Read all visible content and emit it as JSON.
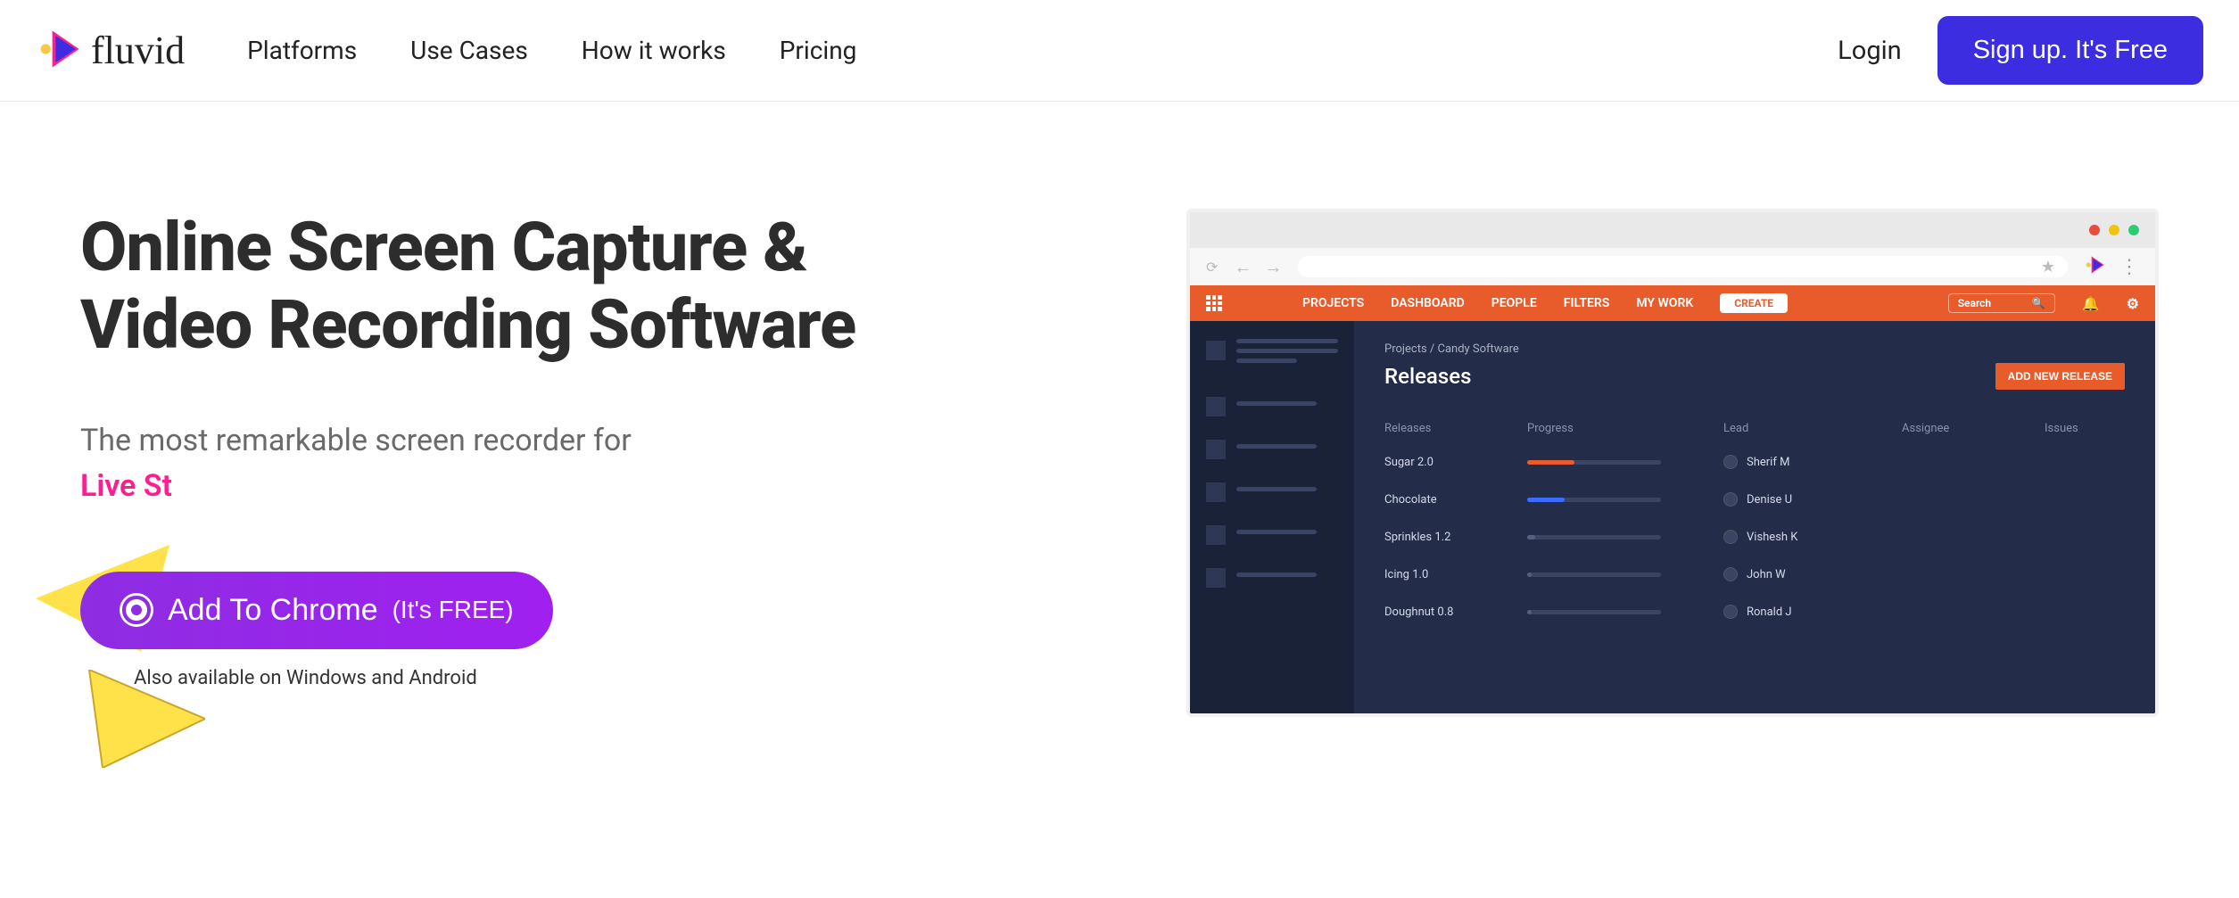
{
  "header": {
    "brand": "fluvid",
    "nav": [
      "Platforms",
      "Use Cases",
      "How it works",
      "Pricing"
    ],
    "login": "Login",
    "signup": "Sign up. It's Free"
  },
  "hero": {
    "headline_l1": "Online Screen Capture &",
    "headline_l2": "Video Recording Software",
    "subhead": "The most remarkable screen recorder for",
    "subhead_accent": "Live St",
    "cta_main": "Add To Chrome",
    "cta_paren": "(It's FREE)",
    "availability": "Also available on Windows and Android"
  },
  "mockup": {
    "topnav": [
      "PROJECTS",
      "DASHBOARD",
      "PEOPLE",
      "FILTERS",
      "MY WORK"
    ],
    "create": "CREATE",
    "search_placeholder": "Search",
    "breadcrumb": "Projects / Candy Software",
    "section_title": "Releases",
    "add_new": "ADD NEW RELEASE",
    "columns": [
      "Releases",
      "Progress",
      "Lead",
      "Assignee",
      "Issues"
    ],
    "rows": [
      {
        "name": "Sugar 2.0",
        "progress_pct": 35,
        "progress_color": "#e85c2c",
        "lead": "Sherif M",
        "has_issue": true
      },
      {
        "name": "Chocolate",
        "progress_pct": 28,
        "progress_color": "#3b6bff",
        "lead": "Denise U",
        "has_issue": false
      },
      {
        "name": "Sprinkles 1.2",
        "progress_pct": 6,
        "progress_color": "#556080",
        "lead": "Vishesh K",
        "has_issue": false
      },
      {
        "name": "Icing 1.0",
        "progress_pct": 3,
        "progress_color": "#556080",
        "lead": "John W",
        "has_issue": false
      },
      {
        "name": "Doughnut 0.8",
        "progress_pct": 3,
        "progress_color": "#556080",
        "lead": "Ronald J",
        "has_issue": false
      }
    ]
  }
}
